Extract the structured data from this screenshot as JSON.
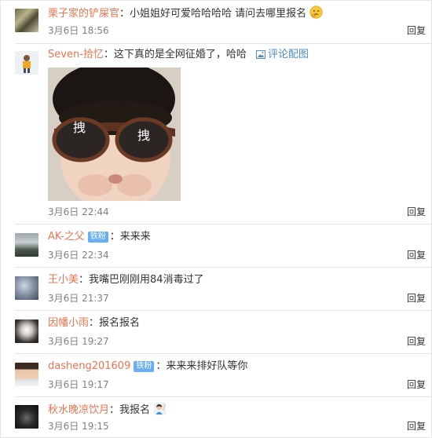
{
  "comments": [
    {
      "user": "栗子家的铲屎官",
      "sep": "：",
      "text": "小姐姐好可爱哈哈哈哈 请问去哪里报名",
      "emoji": "thinking-face-icon",
      "date": "3月6日",
      "time": "18:56",
      "reply": "回复"
    },
    {
      "user": "Seven-拾忆",
      "sep": "：",
      "text": "这下真的是全网征婚了，哈哈",
      "pic_link": "评论配图",
      "photo": {
        "caption_left": "拽",
        "caption_right": "拽"
      },
      "date": "3月6日",
      "time": "22:44",
      "reply": "回复"
    },
    {
      "user": "AK-之父",
      "badge": "铁粉",
      "sep": "：",
      "text": "来来来",
      "date": "3月6日",
      "time": "22:34",
      "reply": "回复"
    },
    {
      "user": "王小美",
      "sep": "：",
      "text": "我嘴巴刚刚用84消毒过了",
      "date": "3月6日",
      "time": "21:37",
      "reply": "回复"
    },
    {
      "user": "因幡小雨",
      "sep": "：",
      "text": "报名报名",
      "date": "3月6日",
      "time": "19:27",
      "reply": "回复"
    },
    {
      "user": "dasheng201609",
      "badge": "铁粉",
      "sep": "：",
      "text": "来来来排好队等你",
      "date": "3月6日",
      "time": "19:17",
      "reply": "回复"
    },
    {
      "user": "秋水晚凉饮月",
      "sep": "：",
      "text": "我报名",
      "emoji": "raising-hand-icon",
      "date": "3月6日",
      "time": "19:15",
      "reply": "回复"
    }
  ]
}
